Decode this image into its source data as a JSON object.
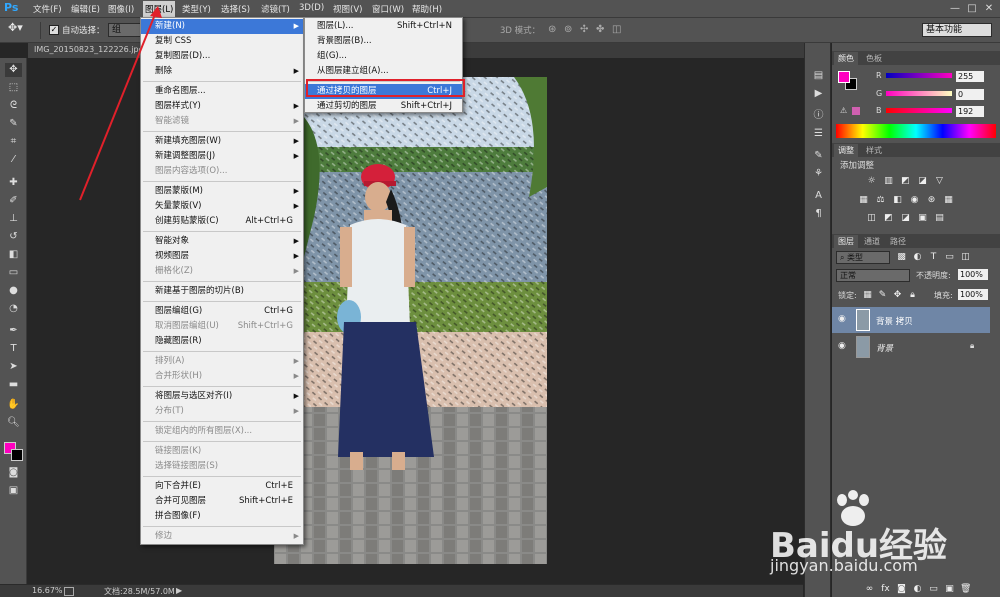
{
  "app": {
    "logo": "Ps"
  },
  "menubar": {
    "items": [
      "文件(F)",
      "编辑(E)",
      "图像(I)",
      "图层(L)",
      "类型(Y)",
      "选择(S)",
      "滤镜(T)",
      "3D(D)",
      "视图(V)",
      "窗口(W)",
      "帮助(H)"
    ],
    "window_buttons": [
      "—",
      "□",
      "✕"
    ]
  },
  "options_bar": {
    "auto_select_label": "自动选择：",
    "auto_select_target": "组",
    "mode_3d_label": "3D 模式：",
    "workspace": "基本功能"
  },
  "document": {
    "tab_title": "IMG_20150823_122226.jpg",
    "zoom": "16.67%",
    "doc_info": "文档:28.5M/57.0M"
  },
  "layer_menu": {
    "items": [
      {
        "label": "新建(N)",
        "shortcut": "",
        "submenu": true,
        "disabled": false,
        "highlight": true
      },
      {
        "label": "复制 CSS",
        "shortcut": "",
        "submenu": false,
        "disabled": false
      },
      {
        "label": "复制图层(D)...",
        "shortcut": "",
        "submenu": false,
        "disabled": false
      },
      {
        "label": "删除",
        "shortcut": "",
        "submenu": true,
        "disabled": false
      },
      {
        "sep": true
      },
      {
        "label": "重命名图层...",
        "shortcut": "",
        "submenu": false,
        "disabled": false
      },
      {
        "label": "图层样式(Y)",
        "shortcut": "",
        "submenu": true,
        "disabled": false
      },
      {
        "label": "智能滤镜",
        "shortcut": "",
        "submenu": true,
        "disabled": true
      },
      {
        "sep": true
      },
      {
        "label": "新建填充图层(W)",
        "shortcut": "",
        "submenu": true,
        "disabled": false
      },
      {
        "label": "新建调整图层(J)",
        "shortcut": "",
        "submenu": true,
        "disabled": false
      },
      {
        "label": "图层内容选项(O)...",
        "shortcut": "",
        "submenu": false,
        "disabled": true
      },
      {
        "sep": true
      },
      {
        "label": "图层蒙版(M)",
        "shortcut": "",
        "submenu": true,
        "disabled": false
      },
      {
        "label": "矢量蒙版(V)",
        "shortcut": "",
        "submenu": true,
        "disabled": false
      },
      {
        "label": "创建剪贴蒙版(C)",
        "shortcut": "Alt+Ctrl+G",
        "submenu": false,
        "disabled": false
      },
      {
        "sep": true
      },
      {
        "label": "智能对象",
        "shortcut": "",
        "submenu": true,
        "disabled": false
      },
      {
        "label": "视频图层",
        "shortcut": "",
        "submenu": true,
        "disabled": false
      },
      {
        "label": "栅格化(Z)",
        "shortcut": "",
        "submenu": true,
        "disabled": true
      },
      {
        "sep": true
      },
      {
        "label": "新建基于图层的切片(B)",
        "shortcut": "",
        "submenu": false,
        "disabled": false
      },
      {
        "sep": true
      },
      {
        "label": "图层编组(G)",
        "shortcut": "Ctrl+G",
        "submenu": false,
        "disabled": false
      },
      {
        "label": "取消图层编组(U)",
        "shortcut": "Shift+Ctrl+G",
        "submenu": false,
        "disabled": true
      },
      {
        "label": "隐藏图层(R)",
        "shortcut": "",
        "submenu": false,
        "disabled": false
      },
      {
        "sep": true
      },
      {
        "label": "排列(A)",
        "shortcut": "",
        "submenu": true,
        "disabled": true
      },
      {
        "label": "合并形状(H)",
        "shortcut": "",
        "submenu": true,
        "disabled": true
      },
      {
        "sep": true
      },
      {
        "label": "将图层与选区对齐(I)",
        "shortcut": "",
        "submenu": true,
        "disabled": false
      },
      {
        "label": "分布(T)",
        "shortcut": "",
        "submenu": true,
        "disabled": true
      },
      {
        "sep": true
      },
      {
        "label": "锁定组内的所有图层(X)...",
        "shortcut": "",
        "submenu": false,
        "disabled": true
      },
      {
        "sep": true
      },
      {
        "label": "链接图层(K)",
        "shortcut": "",
        "submenu": false,
        "disabled": true
      },
      {
        "label": "选择链接图层(S)",
        "shortcut": "",
        "submenu": false,
        "disabled": true
      },
      {
        "sep": true
      },
      {
        "label": "向下合并(E)",
        "shortcut": "Ctrl+E",
        "submenu": false,
        "disabled": false
      },
      {
        "label": "合并可见图层",
        "shortcut": "Shift+Ctrl+E",
        "submenu": false,
        "disabled": false
      },
      {
        "label": "拼合图像(F)",
        "shortcut": "",
        "submenu": false,
        "disabled": false
      },
      {
        "sep": true
      },
      {
        "label": "修边",
        "shortcut": "",
        "submenu": true,
        "disabled": true
      }
    ]
  },
  "new_submenu": {
    "items": [
      {
        "label": "图层(L)...",
        "shortcut": "Shift+Ctrl+N"
      },
      {
        "label": "背景图层(B)...",
        "shortcut": ""
      },
      {
        "label": "组(G)...",
        "shortcut": ""
      },
      {
        "label": "从图层建立组(A)...",
        "shortcut": ""
      },
      {
        "sep": true
      },
      {
        "label": "通过拷贝的图层",
        "shortcut": "Ctrl+J",
        "highlight": true
      },
      {
        "label": "通过剪切的图层",
        "shortcut": "Shift+Ctrl+J"
      }
    ]
  },
  "color_panel": {
    "tabs": [
      "颜色",
      "色板"
    ],
    "r_label": "R",
    "g_label": "G",
    "b_label": "B",
    "r": "255",
    "g": "0",
    "b": "192",
    "foreground": "#ff00c0"
  },
  "adjust_panel": {
    "tabs": [
      "调整",
      "样式"
    ],
    "title": "添加调整"
  },
  "layers_panel": {
    "tabs": [
      "图层",
      "通道",
      "路径"
    ],
    "filter": "类型",
    "blend_mode": "正常",
    "opacity_label": "不透明度:",
    "opacity": "100%",
    "lock_label": "锁定:",
    "fill_label": "填充:",
    "fill": "100%",
    "layers": [
      {
        "name": "背景 拷贝",
        "selected": true
      },
      {
        "name": "背景",
        "selected": false
      }
    ]
  },
  "watermark": {
    "brand": "Baidu经验",
    "url": "jingyan.baidu.com"
  }
}
